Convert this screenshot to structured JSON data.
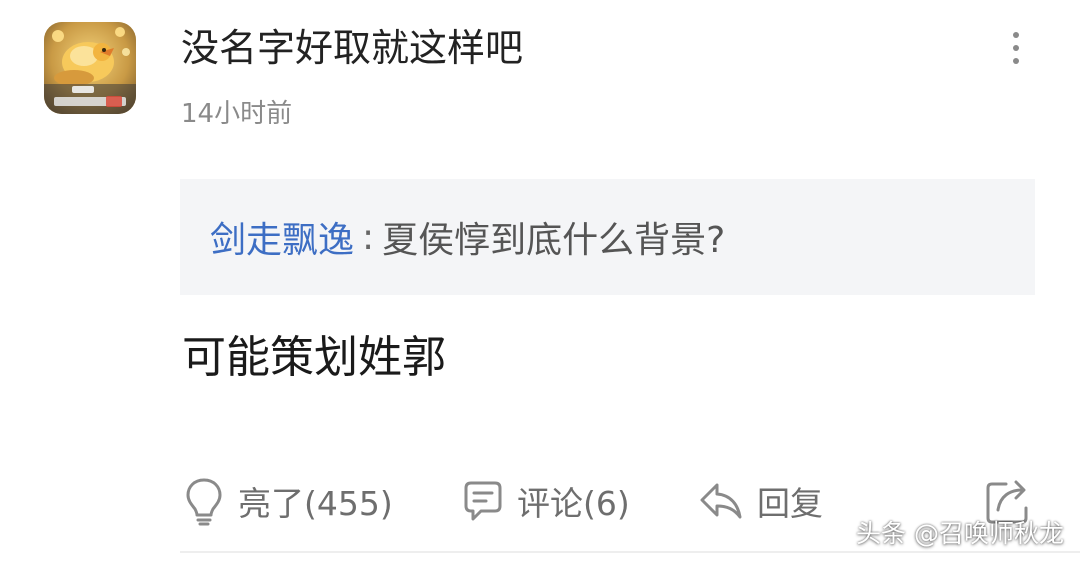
{
  "comment": {
    "username": "没名字好取就这样吧",
    "time": "14小时前",
    "quote": {
      "author": "剑走飘逸",
      "separator": ":",
      "text": "夏侯惇到底什么背景?"
    },
    "reply_text": "可能策划姓郭"
  },
  "actions": {
    "like_label": "亮了(455)",
    "comment_label": "评论(6)",
    "reply_label": "回复"
  },
  "watermark": "头条 @召唤师秋龙",
  "icons": {
    "more": "more-vertical-icon",
    "like": "lightbulb-icon",
    "comment": "comment-bubble-icon",
    "reply": "reply-arrow-icon",
    "share": "share-icon"
  },
  "colors": {
    "quote_author": "#3d6ec4",
    "quote_background": "#f4f5f7",
    "secondary_text": "#8a8a8a",
    "action_text": "#6e6e6e"
  }
}
